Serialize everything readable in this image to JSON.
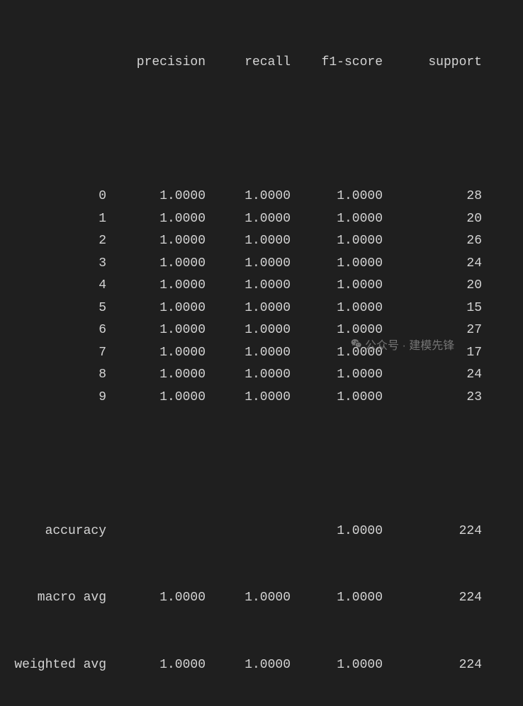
{
  "headers": {
    "label": "",
    "precision": "precision",
    "recall": "recall",
    "f1": "f1-score",
    "support": "support"
  },
  "rows": [
    {
      "label": "0",
      "precision": "1.0000",
      "recall": "1.0000",
      "f1": "1.0000",
      "support": "28"
    },
    {
      "label": "1",
      "precision": "1.0000",
      "recall": "1.0000",
      "f1": "1.0000",
      "support": "20"
    },
    {
      "label": "2",
      "precision": "1.0000",
      "recall": "1.0000",
      "f1": "1.0000",
      "support": "26"
    },
    {
      "label": "3",
      "precision": "1.0000",
      "recall": "1.0000",
      "f1": "1.0000",
      "support": "24"
    },
    {
      "label": "4",
      "precision": "1.0000",
      "recall": "1.0000",
      "f1": "1.0000",
      "support": "20"
    },
    {
      "label": "5",
      "precision": "1.0000",
      "recall": "1.0000",
      "f1": "1.0000",
      "support": "15"
    },
    {
      "label": "6",
      "precision": "1.0000",
      "recall": "1.0000",
      "f1": "1.0000",
      "support": "27"
    },
    {
      "label": "7",
      "precision": "1.0000",
      "recall": "1.0000",
      "f1": "1.0000",
      "support": "17"
    },
    {
      "label": "8",
      "precision": "1.0000",
      "recall": "1.0000",
      "f1": "1.0000",
      "support": "24"
    },
    {
      "label": "9",
      "precision": "1.0000",
      "recall": "1.0000",
      "f1": "1.0000",
      "support": "23"
    }
  ],
  "summary": {
    "accuracy": {
      "label": "accuracy",
      "precision": "",
      "recall": "",
      "f1": "1.0000",
      "support": "224"
    },
    "macro": {
      "label": "macro avg",
      "precision": "1.0000",
      "recall": "1.0000",
      "f1": "1.0000",
      "support": "224"
    },
    "weighted": {
      "label": "weighted avg",
      "precision": "1.0000",
      "recall": "1.0000",
      "f1": "1.0000",
      "support": "224"
    }
  },
  "watermark": {
    "text": "公众号 · 建模先锋"
  }
}
